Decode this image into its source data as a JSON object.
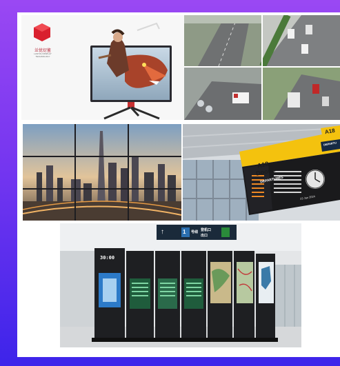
{
  "brand": {
    "name": "兰优衍鉴",
    "subtitle": "LANYOU DISPLAY TECHNOLOGY",
    "logo_color": "#d9202e"
  },
  "airport": {
    "gate_code": "A18",
    "door": "Door 8",
    "departures_label": "DEPARTURES",
    "board_date": "23 Jan 2024",
    "partial_gate": "A18",
    "partial_label": "DEPARTU"
  },
  "kiosk": {
    "clock": "30:00",
    "sign_arrow_up": "↑",
    "sign_icon_1": "1",
    "sign_text_1": "号线",
    "sign_text_2": "登机口",
    "sign_text_3": "出口"
  },
  "colors": {
    "background_top": "#9a48f3",
    "background_bottom": "#3d24ea",
    "airport_sign": "#f4c20e",
    "kiosk_body": "#1e1f22",
    "kiosk_sign": "#1a2a3a"
  }
}
